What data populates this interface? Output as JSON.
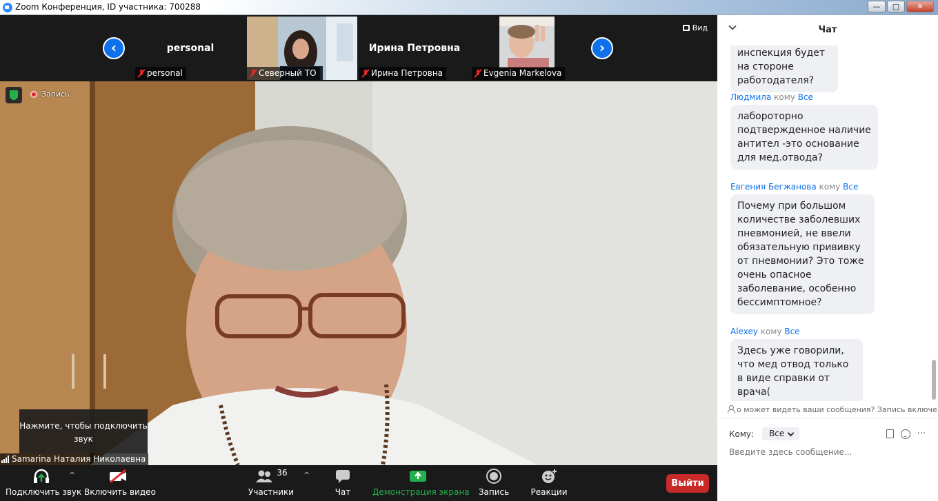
{
  "window": {
    "title": "Zoom Конференция, ID участника: 700288",
    "controls": {
      "minimize": "—",
      "maximize": "▢",
      "close": "✕"
    }
  },
  "strip": {
    "prev_arrow": "‹",
    "next_arrow": "›",
    "view_label": "Вид",
    "thumbnails": [
      {
        "big_name": "personal",
        "name": "personal",
        "has_video": false
      },
      {
        "big_name": "",
        "name": "Северный ТО",
        "has_video": true
      },
      {
        "big_name": "Ирина Петровна",
        "name": "Ирина Петровна",
        "has_video": false
      },
      {
        "big_name": "",
        "name": "Evgenia Markelova",
        "has_video": true
      }
    ]
  },
  "main_video": {
    "recording_label": "Запись",
    "audio_tip": "Нажмите, чтобы подключить звук",
    "speaker_name": "Samarina Наталия Николаевна"
  },
  "toolbar": {
    "audio_label": "Подключить звук",
    "video_label": "Включить видео",
    "participants_label": "Участники",
    "participants_count": "36",
    "chat_label": "Чат",
    "share_label": "Демонстрация экрана",
    "record_label": "Запись",
    "reactions_label": "Реакции",
    "end_label": "Выйти",
    "share_color": "#22b14c",
    "end_color": "#c82a2a"
  },
  "chat": {
    "title": "Чат",
    "messages": [
      {
        "sender": "",
        "to_word": "",
        "to": "",
        "text": "инспекция будет на стороне работодателя?"
      },
      {
        "sender": "Людмила",
        "to_word": "кому",
        "to": "Все",
        "text": "лабороторно подтвержденное наличие антител -это основание для мед.отвода?"
      },
      {
        "sender": "Евгения Бегжанова",
        "to_word": "кому",
        "to": "Все",
        "text": "Почему при большом количестве заболевших пневмонией, не ввели обязательную прививку от пневмонии? Это тоже очень опасное заболевание, особенно бессимптомное?"
      },
      {
        "sender": "Alexey",
        "to_word": "кому",
        "to": "Все",
        "text": "Здесь уже говорили, что мед отвод только в виде справки от врача("
      }
    ],
    "notice": "о может видеть ваши сообщения? Запись включе",
    "to_label": "Кому:",
    "to_value": "Все",
    "more_label": "···",
    "input_placeholder": "Введите здесь сообщение...",
    "accent_color": "#0e71eb"
  }
}
